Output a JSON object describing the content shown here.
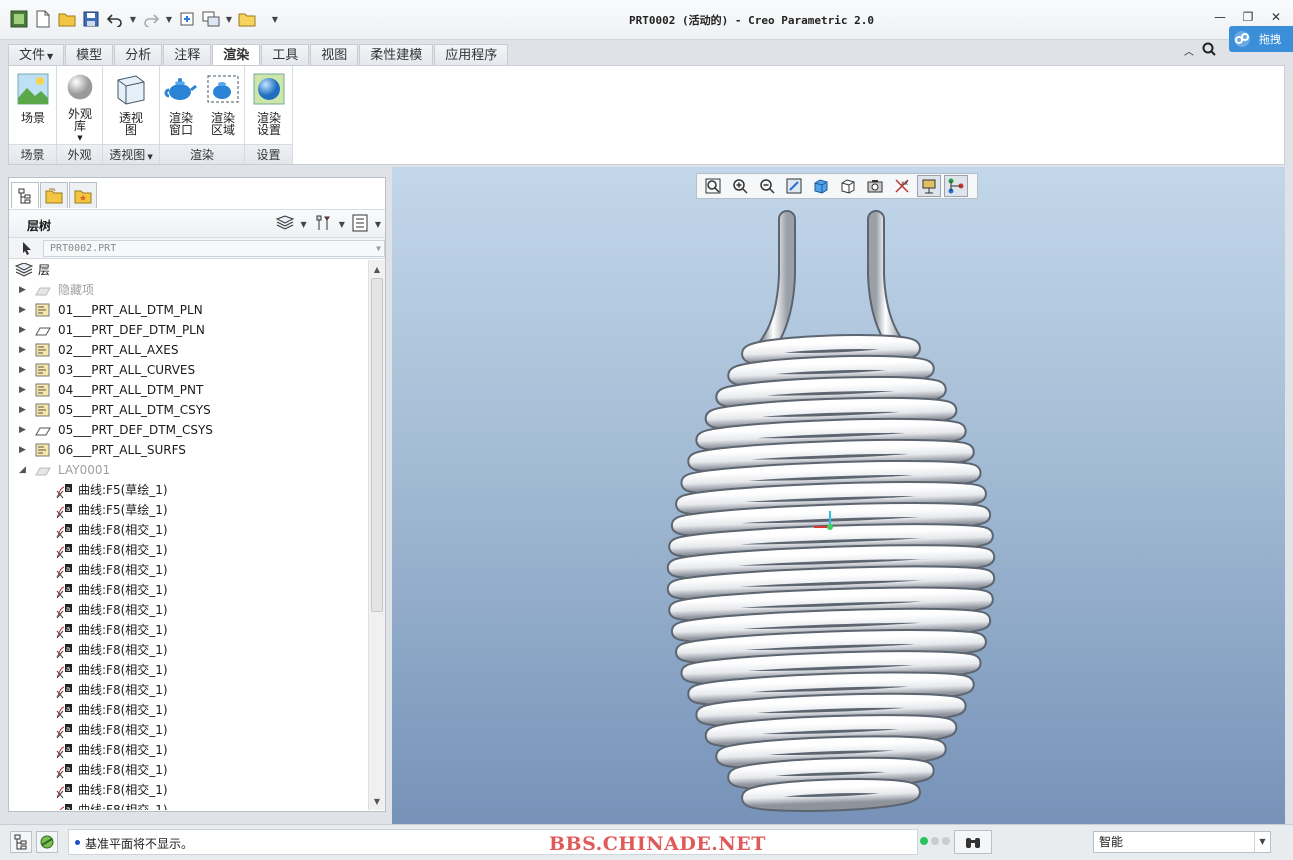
{
  "window": {
    "title": "PRT0002 (活动的) - Creo Parametric 2.0"
  },
  "menu_tabs": [
    {
      "label": "文件",
      "has_dropdown": true
    },
    {
      "label": "模型"
    },
    {
      "label": "分析"
    },
    {
      "label": "注释"
    },
    {
      "label": "渲染",
      "active": true
    },
    {
      "label": "工具"
    },
    {
      "label": "视图"
    },
    {
      "label": "柔性建模"
    },
    {
      "label": "应用程序"
    }
  ],
  "drag_tab": {
    "label": "拖拽"
  },
  "ribbon": {
    "groups": [
      {
        "label": "场景",
        "buttons": [
          {
            "label": "场景",
            "icon": "scene-icon"
          }
        ]
      },
      {
        "label": "外观",
        "buttons": [
          {
            "label": "外观库",
            "icon": "appearance-sphere-icon"
          }
        ]
      },
      {
        "label": "透视图",
        "buttons": [
          {
            "label": "透视图",
            "icon": "perspective-cube-icon"
          }
        ]
      },
      {
        "label": "渲染",
        "buttons": [
          {
            "label": "渲染窗口",
            "icon": "teapot-icon"
          },
          {
            "label": "渲染区域",
            "icon": "teapot-region-icon"
          }
        ]
      },
      {
        "label": "设置",
        "buttons": [
          {
            "label": "渲染设置",
            "icon": "render-settings-icon"
          }
        ]
      }
    ]
  },
  "tree_panel": {
    "title": "层树",
    "model_selector": "PRT0002.PRT",
    "root_label": "层",
    "layers": [
      {
        "label": "隐藏项",
        "dim": true
      },
      {
        "label": "01___PRT_ALL_DTM_PLN"
      },
      {
        "label": "01___PRT_DEF_DTM_PLN",
        "icon": "plane"
      },
      {
        "label": "02___PRT_ALL_AXES"
      },
      {
        "label": "03___PRT_ALL_CURVES"
      },
      {
        "label": "04___PRT_ALL_DTM_PNT"
      },
      {
        "label": "05___PRT_ALL_DTM_CSYS"
      },
      {
        "label": "05___PRT_DEF_DTM_CSYS",
        "icon": "plane"
      },
      {
        "label": "06___PRT_ALL_SURFS"
      },
      {
        "label": "LAY0001",
        "dim": true,
        "expanded": true
      }
    ],
    "curves": [
      "曲线:F5(草绘_1)",
      "曲线:F5(草绘_1)",
      "曲线:F8(相交_1)",
      "曲线:F8(相交_1)",
      "曲线:F8(相交_1)",
      "曲线:F8(相交_1)",
      "曲线:F8(相交_1)",
      "曲线:F8(相交_1)",
      "曲线:F8(相交_1)",
      "曲线:F8(相交_1)",
      "曲线:F8(相交_1)",
      "曲线:F8(相交_1)",
      "曲线:F8(相交_1)",
      "曲线:F8(相交_1)",
      "曲线:F8(相交_1)",
      "曲线:F8(相交_1)",
      "曲线:F8(相交_1)"
    ]
  },
  "status": {
    "message": "基准平面将不显示。",
    "watermark": "BBS.CHINADE.NET",
    "filter_value": "智能"
  },
  "colors": {
    "accent": "#3b8fd9",
    "viewport_top": "#c3d7ea",
    "viewport_bottom": "#7692b8",
    "watermark": "#e05a5a"
  }
}
